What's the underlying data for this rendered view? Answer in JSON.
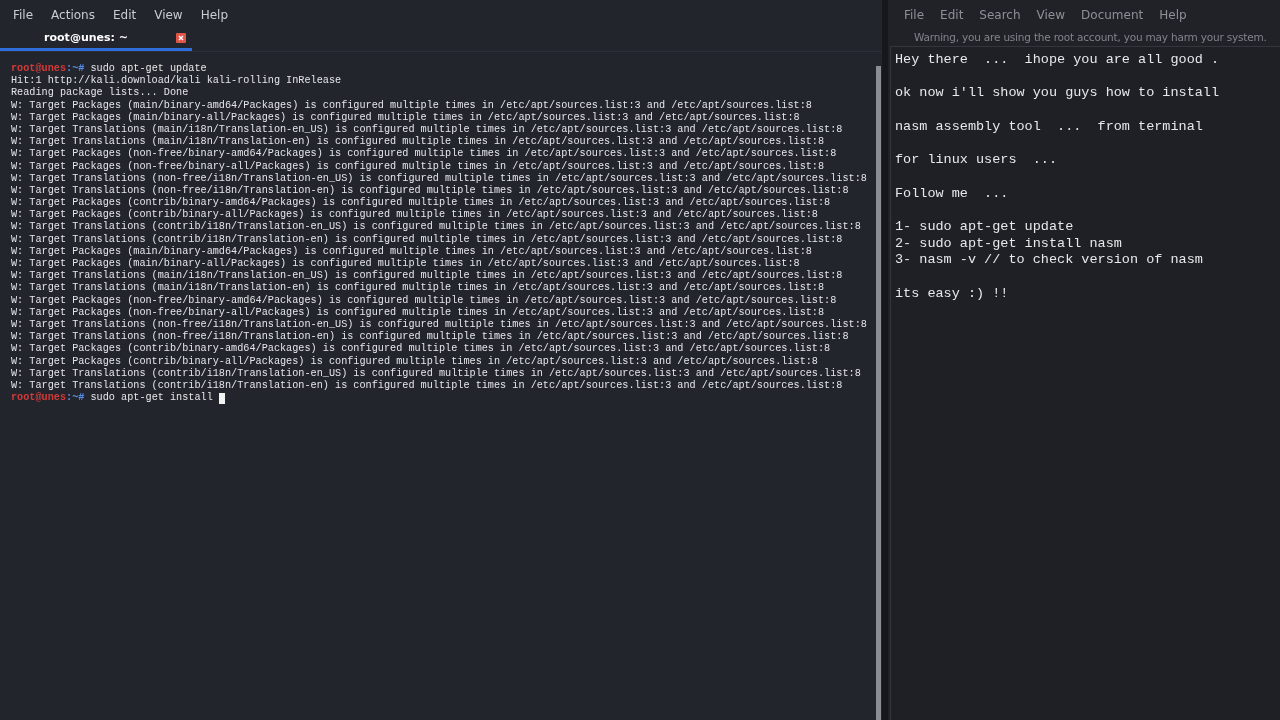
{
  "terminal": {
    "menu": [
      "File",
      "Actions",
      "Edit",
      "View",
      "Help"
    ],
    "tabs": [
      {
        "title": "root@unes: ~",
        "selected": true
      }
    ],
    "lines": [
      {
        "kind": "prompt",
        "user": "root@unes",
        "path": ":~# ",
        "command": "sudo apt-get update",
        "cursor": false
      },
      {
        "kind": "output",
        "text": "Hit:1 http://kali.download/kali kali-rolling InRelease"
      },
      {
        "kind": "output",
        "text": "Reading package lists... Done"
      },
      {
        "kind": "output",
        "text": "W: Target Packages (main/binary-amd64/Packages) is configured multiple times in /etc/apt/sources.list:3 and /etc/apt/sources.list:8"
      },
      {
        "kind": "output",
        "text": "W: Target Packages (main/binary-all/Packages) is configured multiple times in /etc/apt/sources.list:3 and /etc/apt/sources.list:8"
      },
      {
        "kind": "output",
        "text": "W: Target Translations (main/i18n/Translation-en_US) is configured multiple times in /etc/apt/sources.list:3 and /etc/apt/sources.list:8"
      },
      {
        "kind": "output",
        "text": "W: Target Translations (main/i18n/Translation-en) is configured multiple times in /etc/apt/sources.list:3 and /etc/apt/sources.list:8"
      },
      {
        "kind": "output",
        "text": "W: Target Packages (non-free/binary-amd64/Packages) is configured multiple times in /etc/apt/sources.list:3 and /etc/apt/sources.list:8"
      },
      {
        "kind": "output",
        "text": "W: Target Packages (non-free/binary-all/Packages) is configured multiple times in /etc/apt/sources.list:3 and /etc/apt/sources.list:8"
      },
      {
        "kind": "output",
        "text": "W: Target Translations (non-free/i18n/Translation-en_US) is configured multiple times in /etc/apt/sources.list:3 and /etc/apt/sources.list:8"
      },
      {
        "kind": "output",
        "text": "W: Target Translations (non-free/i18n/Translation-en) is configured multiple times in /etc/apt/sources.list:3 and /etc/apt/sources.list:8"
      },
      {
        "kind": "output",
        "text": "W: Target Packages (contrib/binary-amd64/Packages) is configured multiple times in /etc/apt/sources.list:3 and /etc/apt/sources.list:8"
      },
      {
        "kind": "output",
        "text": "W: Target Packages (contrib/binary-all/Packages) is configured multiple times in /etc/apt/sources.list:3 and /etc/apt/sources.list:8"
      },
      {
        "kind": "output",
        "text": "W: Target Translations (contrib/i18n/Translation-en_US) is configured multiple times in /etc/apt/sources.list:3 and /etc/apt/sources.list:8"
      },
      {
        "kind": "output",
        "text": "W: Target Translations (contrib/i18n/Translation-en) is configured multiple times in /etc/apt/sources.list:3 and /etc/apt/sources.list:8"
      },
      {
        "kind": "output",
        "text": "W: Target Packages (main/binary-amd64/Packages) is configured multiple times in /etc/apt/sources.list:3 and /etc/apt/sources.list:8"
      },
      {
        "kind": "output",
        "text": "W: Target Packages (main/binary-all/Packages) is configured multiple times in /etc/apt/sources.list:3 and /etc/apt/sources.list:8"
      },
      {
        "kind": "output",
        "text": "W: Target Translations (main/i18n/Translation-en_US) is configured multiple times in /etc/apt/sources.list:3 and /etc/apt/sources.list:8"
      },
      {
        "kind": "output",
        "text": "W: Target Translations (main/i18n/Translation-en) is configured multiple times in /etc/apt/sources.list:3 and /etc/apt/sources.list:8"
      },
      {
        "kind": "output",
        "text": "W: Target Packages (non-free/binary-amd64/Packages) is configured multiple times in /etc/apt/sources.list:3 and /etc/apt/sources.list:8"
      },
      {
        "kind": "output",
        "text": "W: Target Packages (non-free/binary-all/Packages) is configured multiple times in /etc/apt/sources.list:3 and /etc/apt/sources.list:8"
      },
      {
        "kind": "output",
        "text": "W: Target Translations (non-free/i18n/Translation-en_US) is configured multiple times in /etc/apt/sources.list:3 and /etc/apt/sources.list:8"
      },
      {
        "kind": "output",
        "text": "W: Target Translations (non-free/i18n/Translation-en) is configured multiple times in /etc/apt/sources.list:3 and /etc/apt/sources.list:8"
      },
      {
        "kind": "output",
        "text": "W: Target Packages (contrib/binary-amd64/Packages) is configured multiple times in /etc/apt/sources.list:3 and /etc/apt/sources.list:8"
      },
      {
        "kind": "output",
        "text": "W: Target Packages (contrib/binary-all/Packages) is configured multiple times in /etc/apt/sources.list:3 and /etc/apt/sources.list:8"
      },
      {
        "kind": "output",
        "text": "W: Target Translations (contrib/i18n/Translation-en_US) is configured multiple times in /etc/apt/sources.list:3 and /etc/apt/sources.list:8"
      },
      {
        "kind": "output",
        "text": "W: Target Translations (contrib/i18n/Translation-en) is configured multiple times in /etc/apt/sources.list:3 and /etc/apt/sources.list:8"
      },
      {
        "kind": "prompt",
        "user": "root@unes",
        "path": ":~# ",
        "command": "sudo apt-get install ",
        "cursor": true
      }
    ]
  },
  "editor": {
    "menu": [
      "File",
      "Edit",
      "Search",
      "View",
      "Document",
      "Help"
    ],
    "warning": "Warning, you are using the root account, you may harm your system.",
    "blocks": [
      [
        "Hey there  ...  ihope you are all good ."
      ],
      [
        "ok now i'll show you guys how to install"
      ],
      [
        "nasm assembly tool  ...  from terminal"
      ],
      [
        "for linux users  ..."
      ],
      [
        "Follow me  ..."
      ],
      [
        "1- sudo apt-get update",
        "2- sudo apt-get install nasm",
        "3- nasm -v // to check version of nasm"
      ],
      [
        "its easy :) !!"
      ]
    ]
  }
}
